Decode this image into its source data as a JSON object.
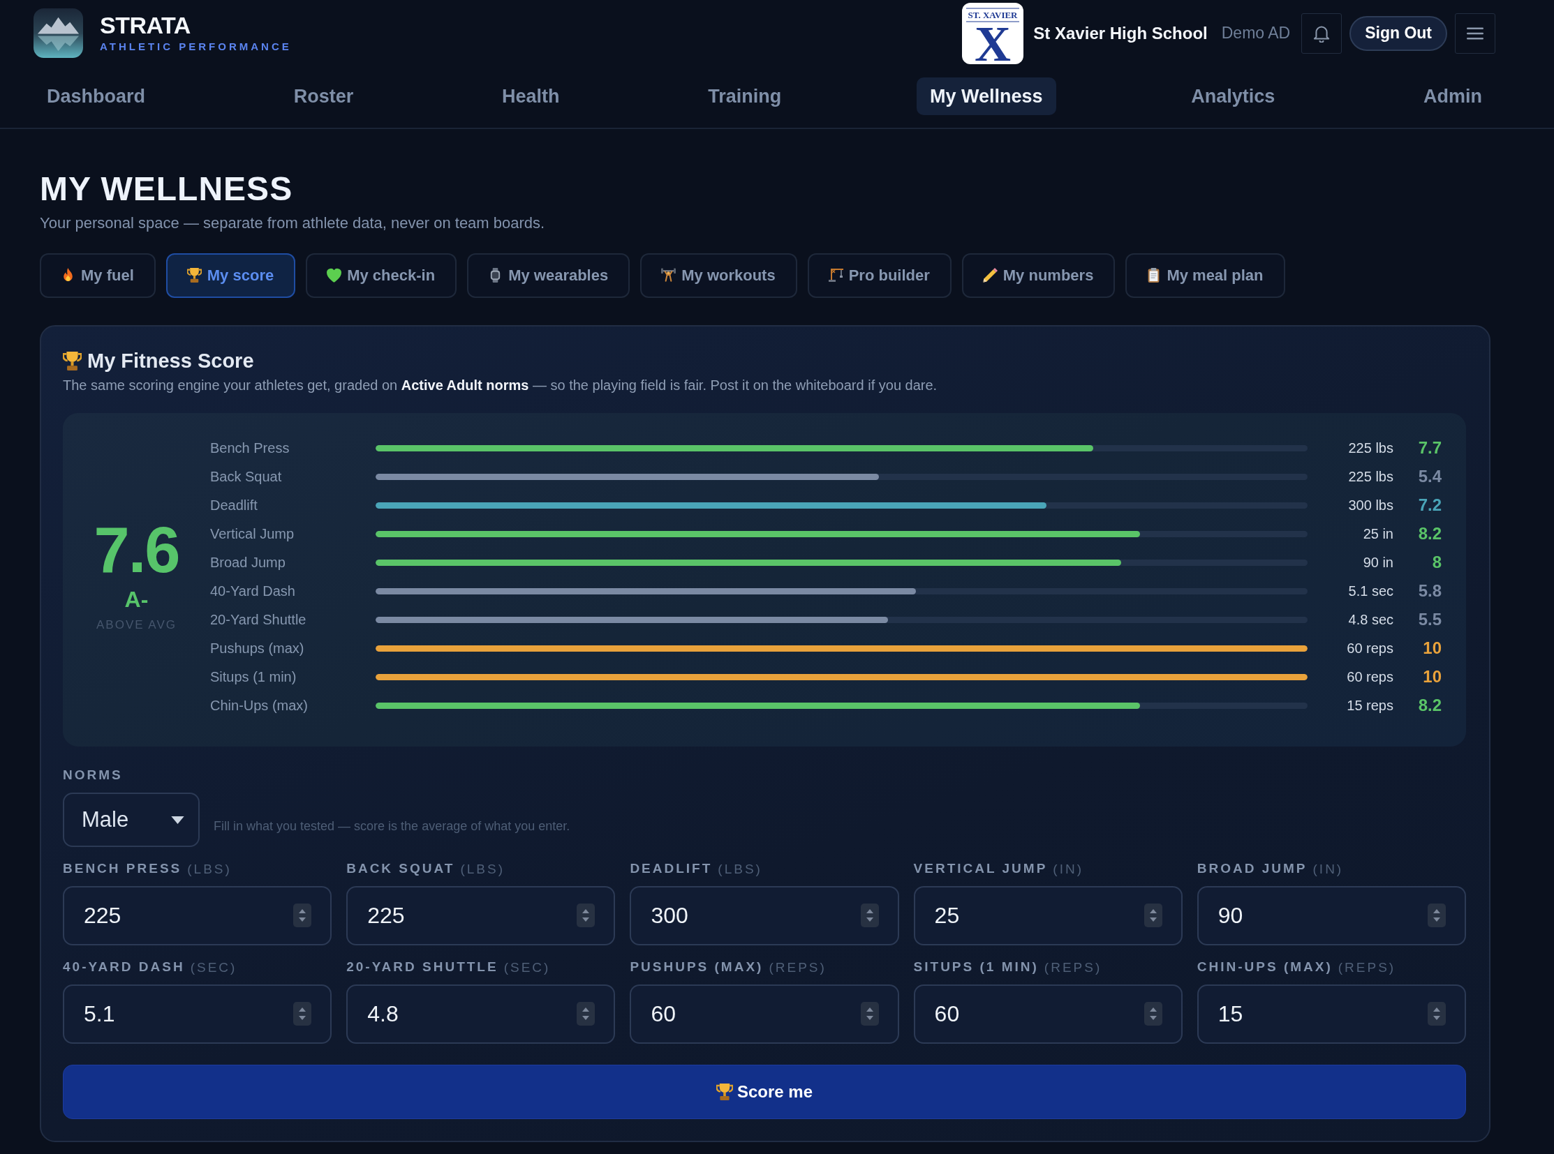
{
  "header": {
    "brand": {
      "name": "STRATA",
      "tagline": "ATHLETIC PERFORMANCE"
    },
    "school_logo": {
      "letter": "X",
      "text": "ST. XAVIER"
    },
    "school_name": "St Xavier High School",
    "user": "Demo AD",
    "sign_out": "Sign Out"
  },
  "nav": [
    {
      "label": "Dashboard",
      "selected": false
    },
    {
      "label": "Roster",
      "selected": false
    },
    {
      "label": "Health",
      "selected": false
    },
    {
      "label": "Training",
      "selected": false
    },
    {
      "label": "My Wellness",
      "selected": true
    },
    {
      "label": "Analytics",
      "selected": false
    },
    {
      "label": "Admin",
      "selected": false
    }
  ],
  "page": {
    "title": "MY WELLNESS",
    "subtitle": "Your personal space — separate from athlete data, never on team boards."
  },
  "tabs": [
    {
      "label": "My fuel",
      "selected": false
    },
    {
      "label": "My score",
      "selected": true
    },
    {
      "label": "My check-in",
      "selected": false
    },
    {
      "label": "My wearables",
      "selected": false
    },
    {
      "label": "My workouts",
      "selected": false
    },
    {
      "label": "Pro builder",
      "selected": false
    },
    {
      "label": "My numbers",
      "selected": false
    },
    {
      "label": "My meal plan",
      "selected": false
    }
  ],
  "fitness_score": {
    "title": "My Fitness Score",
    "description": "The same scoring engine your athletes get, graded on **Active Adult norms** — so the playing field is fair. Post it on the whiteboard if you dare.",
    "summary": {
      "score": "7.6",
      "grade": "A-",
      "rating": "ABOVE AVG"
    },
    "metrics": [
      {
        "name": "Bench Press",
        "level": 0.77,
        "reading": "225 lbs",
        "score": "7.7",
        "color": "#5ac468"
      },
      {
        "name": "Back Squat",
        "level": 0.54,
        "reading": "225 lbs",
        "score": "5.4",
        "color": "#7b8aa3"
      },
      {
        "name": "Deadlift",
        "level": 0.72,
        "reading": "300 lbs",
        "score": "7.2",
        "color": "#4aa5b8"
      },
      {
        "name": "Vertical Jump",
        "level": 0.82,
        "reading": "25 in",
        "score": "8.2",
        "color": "#5ac468"
      },
      {
        "name": "Broad Jump",
        "level": 0.8,
        "reading": "90 in",
        "score": "8",
        "color": "#5ac468"
      },
      {
        "name": "40-Yard Dash",
        "level": 0.58,
        "reading": "5.1 sec",
        "score": "5.8",
        "color": "#7b8aa3"
      },
      {
        "name": "20-Yard Shuttle",
        "level": 0.55,
        "reading": "4.8 sec",
        "score": "5.5",
        "color": "#7b8aa3"
      },
      {
        "name": "Pushups (max)",
        "level": 1,
        "reading": "60 reps",
        "score": "10",
        "color": "#e9a23b"
      },
      {
        "name": "Situps (1 min)",
        "level": 1,
        "reading": "60 reps",
        "score": "10",
        "color": "#e9a23b"
      },
      {
        "name": "Chin-Ups (max)",
        "level": 0.82,
        "reading": "15 reps",
        "score": "8.2",
        "color": "#5ac468"
      }
    ],
    "norms": {
      "label": "NORMS",
      "value": "Male",
      "hint": "Fill in what you tested — score is the average of what you enter."
    },
    "fields": [
      {
        "label": "BENCH PRESS",
        "unit": "(LBS)",
        "value": "225"
      },
      {
        "label": "BACK SQUAT",
        "unit": "(LBS)",
        "value": "225"
      },
      {
        "label": "DEADLIFT",
        "unit": "(LBS)",
        "value": "300"
      },
      {
        "label": "VERTICAL JUMP",
        "unit": "(IN)",
        "value": "25"
      },
      {
        "label": "BROAD JUMP",
        "unit": "(IN)",
        "value": "90"
      },
      {
        "label": "40-YARD DASH",
        "unit": "(SEC)",
        "value": "5.1"
      },
      {
        "label": "20-YARD SHUTTLE",
        "unit": "(SEC)",
        "value": "4.8"
      },
      {
        "label": "PUSHUPS (MAX)",
        "unit": "(REPS)",
        "value": "60"
      },
      {
        "label": "SITUPS (1 MIN)",
        "unit": "(REPS)",
        "value": "60"
      },
      {
        "label": "CHIN-UPS (MAX)",
        "unit": "(REPS)",
        "value": "15"
      }
    ],
    "button": "Score me"
  }
}
